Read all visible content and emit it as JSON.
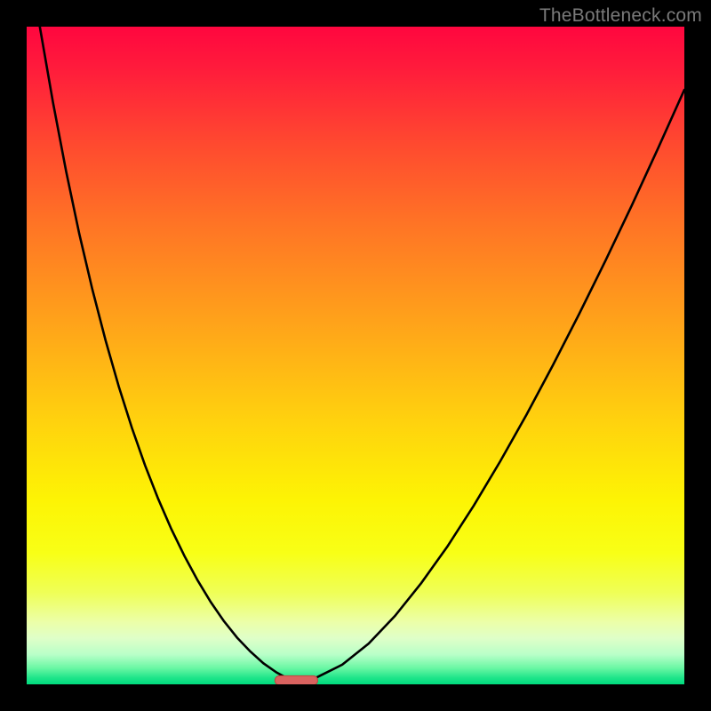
{
  "watermark": "TheBottleneck.com",
  "colors": {
    "frame": "#000000",
    "curve": "#000000",
    "marker_fill": "#d9625f",
    "marker_stroke": "#c2423f",
    "gradient_stops": [
      {
        "offset": 0.0,
        "color": "#ff063f"
      },
      {
        "offset": 0.07,
        "color": "#ff1e3b"
      },
      {
        "offset": 0.18,
        "color": "#ff4a2f"
      },
      {
        "offset": 0.3,
        "color": "#ff7425"
      },
      {
        "offset": 0.45,
        "color": "#ffa31a"
      },
      {
        "offset": 0.6,
        "color": "#ffd20e"
      },
      {
        "offset": 0.72,
        "color": "#fdf404"
      },
      {
        "offset": 0.8,
        "color": "#f8ff16"
      },
      {
        "offset": 0.86,
        "color": "#efff56"
      },
      {
        "offset": 0.905,
        "color": "#ecffa8"
      },
      {
        "offset": 0.93,
        "color": "#dfffc8"
      },
      {
        "offset": 0.955,
        "color": "#b8ffc8"
      },
      {
        "offset": 0.975,
        "color": "#6bf7a4"
      },
      {
        "offset": 0.99,
        "color": "#1fe58a"
      },
      {
        "offset": 1.0,
        "color": "#00db7e"
      }
    ]
  },
  "chart_data": {
    "type": "line",
    "title": "",
    "xlabel": "",
    "ylabel": "",
    "xlim": [
      0,
      100
    ],
    "ylim": [
      0,
      100
    ],
    "grid": false,
    "legend": false,
    "marker": {
      "x": 41,
      "y": 0.6,
      "width": 6.5,
      "height": 1.4
    },
    "left_curve_x": [
      0,
      2,
      4,
      6,
      8,
      10,
      12,
      14,
      16,
      18,
      20,
      22,
      24,
      26,
      28,
      30,
      32,
      34,
      36,
      38,
      40,
      41
    ],
    "left_curve_y": [
      112,
      100,
      88.5,
      78,
      68.5,
      60,
      52.3,
      45.3,
      39,
      33.3,
      28.2,
      23.6,
      19.5,
      15.8,
      12.5,
      9.6,
      7.1,
      5,
      3.2,
      1.8,
      0.7,
      0.2
    ],
    "right_curve_x": [
      41,
      44,
      48,
      52,
      56,
      60,
      64,
      68,
      72,
      76,
      80,
      84,
      88,
      92,
      96,
      100
    ],
    "right_curve_y": [
      0.2,
      1.0,
      3.0,
      6.2,
      10.4,
      15.4,
      21.0,
      27.2,
      33.9,
      41.0,
      48.5,
      56.3,
      64.4,
      72.8,
      81.5,
      90.4
    ]
  }
}
